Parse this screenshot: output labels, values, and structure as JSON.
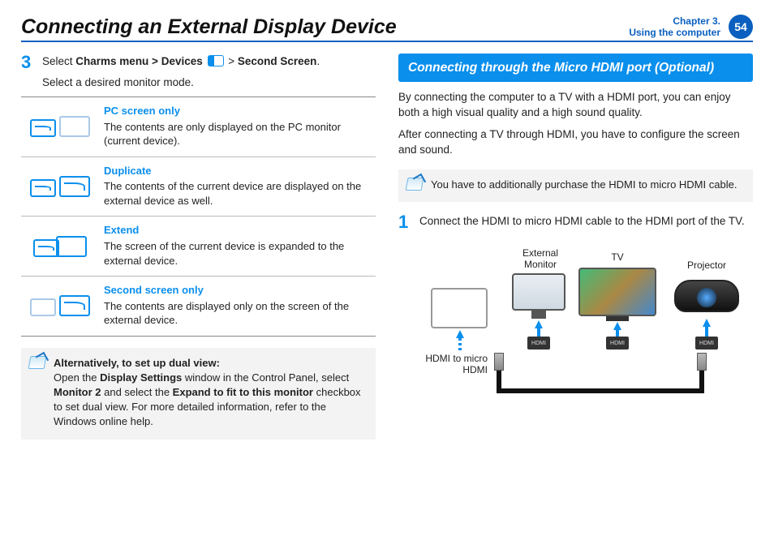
{
  "header": {
    "title": "Connecting an External Display Device",
    "chapter_line1": "Chapter 3.",
    "chapter_line2": "Using the computer",
    "page_number": "54"
  },
  "left": {
    "step3_num": "3",
    "step3_line1_a": "Select ",
    "step3_line1_b": "Charms menu > Devices",
    "step3_line1_c": " > ",
    "step3_line1_d": "Second Screen",
    "step3_line1_e": ".",
    "step3_line2": "Select a desired monitor mode.",
    "modes": [
      {
        "name": "PC screen only",
        "desc": "The contents are only displayed on the PC monitor (current device)."
      },
      {
        "name": "Duplicate",
        "desc": "The contents of the current device are displayed on the external device as well."
      },
      {
        "name": "Extend",
        "desc": "The screen of the current device is expanded to the external device."
      },
      {
        "name": "Second screen only",
        "desc": "The contents are displayed only on the screen of the external device."
      }
    ],
    "note_title": "Alternatively, to set up dual view:",
    "note_a": "Open the ",
    "note_b": "Display Settings",
    "note_c": " window in the Control Panel, select ",
    "note_d": "Monitor 2",
    "note_e": " and select the ",
    "note_f": "Expand to fit to this monitor",
    "note_g": " checkbox to set dual view. For more detailed information, refer to the Windows online help."
  },
  "right": {
    "section_title": "Connecting through the Micro HDMI port (Optional)",
    "para1": "By connecting the computer to a TV with a HDMI port, you can enjoy both a high visual quality and a high sound quality.",
    "para2": "After connecting a TV through HDMI, you have to configure the screen and sound.",
    "note": "You have to additionally purchase the HDMI to micro HDMI cable.",
    "step1_num": "1",
    "step1_text": "Connect the HDMI to micro HDMI cable to the HDMI port of the TV.",
    "diagram": {
      "label_ext": "External Monitor",
      "label_tv": "TV",
      "label_proj": "Projector",
      "label_cable": "HDMI to micro HDMI",
      "hdmi_text": "HDMI"
    }
  }
}
